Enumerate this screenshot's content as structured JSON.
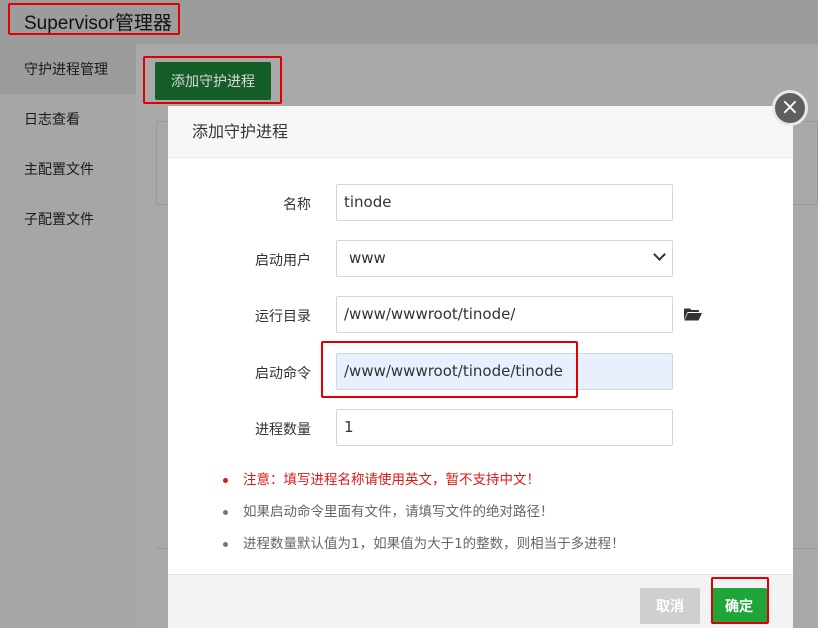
{
  "app": {
    "title": "Supervisor管理器"
  },
  "sidebar": {
    "items": [
      {
        "label": "守护进程管理"
      },
      {
        "label": "日志查看"
      },
      {
        "label": "主配置文件"
      },
      {
        "label": "子配置文件"
      }
    ]
  },
  "toolbar": {
    "add_label": "添加守护进程"
  },
  "modal": {
    "title": "添加守护进程",
    "close_glyph": "×",
    "fields": {
      "name": {
        "label": "名称",
        "value": "tinode"
      },
      "user": {
        "label": "启动用户",
        "value": "www"
      },
      "dir": {
        "label": "运行目录",
        "value": "/www/wwwroot/tinode/"
      },
      "command": {
        "label": "启动命令",
        "value": "/www/wwwroot/tinode/tinode"
      },
      "count": {
        "label": "进程数量",
        "value": "1"
      }
    },
    "notes": [
      "注意：填写进程名称请使用英文，暂不支持中文！",
      "如果启动命令里面有文件，请填写文件的绝对路径！",
      "进程数量默认值为1，如果值为大于1的整数，则相当于多进程！"
    ],
    "cancel_label": "取消",
    "ok_label": "确定"
  },
  "colors": {
    "accent": "#20a53a",
    "warning": "#e01818",
    "highlight": "#e00000"
  }
}
